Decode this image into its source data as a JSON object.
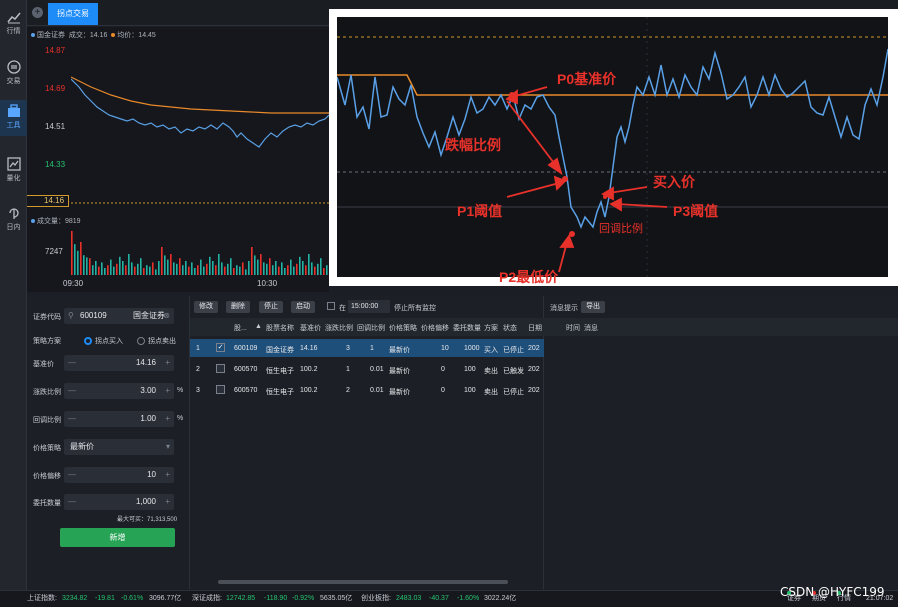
{
  "nav": {
    "items": [
      {
        "label": "行情"
      },
      {
        "label": "交易"
      },
      {
        "label": "工具"
      },
      {
        "label": "量化"
      },
      {
        "label": "日内"
      }
    ]
  },
  "tabs": {
    "active": "拐点交易"
  },
  "chart": {
    "legend_stock": "国金证券",
    "legend_price": "成交：14.16",
    "legend_avg": "均价：14.45",
    "y_labels": [
      "14.87",
      "14.69",
      "14.51",
      "14.33",
      "14.16"
    ],
    "current_price": "14.16",
    "volume_legend": "成交量：9819",
    "volume_label": "7247",
    "time_labels": [
      "09:30",
      "10:30"
    ],
    "colors": {
      "price": "#5aa0e6",
      "avg": "#e8892a",
      "up": "#e8312a",
      "down": "#22b3a5"
    }
  },
  "annotation": {
    "p0": "P0基准价",
    "drop": "跌幅比例",
    "p1": "P1阈值",
    "buy": "买入价",
    "p3": "P3阈值",
    "rebound": "回调比例",
    "p2": "P2最低价"
  },
  "form": {
    "code_label": "证券代码",
    "code_value": "600109",
    "code_name": "国金证券",
    "strategy_label": "策略方案",
    "opt_buy": "拐点买入",
    "opt_sell": "拐点卖出",
    "base_label": "基准价",
    "base_value": "14.16",
    "drop_label": "涨跌比例",
    "drop_value": "3.00",
    "rebound_label": "回调比例",
    "rebound_value": "1.00",
    "pct": "%",
    "price_strategy_label": "价格策略",
    "price_strategy_value": "最新价",
    "offset_label": "价格偏移",
    "offset_value": "10",
    "qty_label": "委托数量",
    "qty_value": "1,000",
    "max_buy": "最大可买：71,313,500",
    "submit": "新增"
  },
  "toolbar": {
    "edit": "修改",
    "delete": "删除",
    "stop": "停止",
    "start": "启动",
    "at": "在",
    "time": "15:00:00",
    "stop_all": "停止所有监控"
  },
  "table": {
    "headers": [
      "",
      "股...",
      "股票名称",
      "基准价",
      "涨跌比例",
      "回调比例",
      "价格策略",
      "价格偏移",
      "委托数量",
      "方案",
      "状态",
      "日期"
    ],
    "rows": [
      [
        "1",
        "600109",
        "国金证券",
        "14.16",
        "3",
        "1",
        "最新价",
        "10",
        "1000",
        "买入",
        "已停止",
        "202"
      ],
      [
        "2",
        "600570",
        "恒生电子",
        "100.2",
        "1",
        "0.01",
        "最新价",
        "0",
        "100",
        "卖出",
        "已触发",
        "202"
      ],
      [
        "3",
        "600570",
        "恒生电子",
        "100.2",
        "2",
        "0.01",
        "最新价",
        "0",
        "100",
        "卖出",
        "已停止",
        "202"
      ]
    ]
  },
  "messages": {
    "title": "消息提示",
    "export": "导出",
    "col_time": "时间",
    "col_msg": "消息"
  },
  "status": {
    "sh_label": "上证指数:",
    "sh_value": "3234.82",
    "sh_change": "-19.81",
    "sh_pct": "-0.61%",
    "sh_amount": "3096.77亿",
    "sz_label": "深证成指:",
    "sz_value": "12742.85",
    "sz_change": "-118.90",
    "sz_pct": "-0.92%",
    "sz_amount": "5635.05亿",
    "cy_label": "创业板指:",
    "cy_value": "2483.03",
    "cy_change": "-40.37",
    "cy_pct": "-1.60%",
    "cy_amount": "3022.24亿",
    "ind_1": "证券",
    "ind_2": "期货",
    "ind_3": "行情",
    "clock": "21:07:02"
  },
  "watermark": "CSDN @HYFC199"
}
